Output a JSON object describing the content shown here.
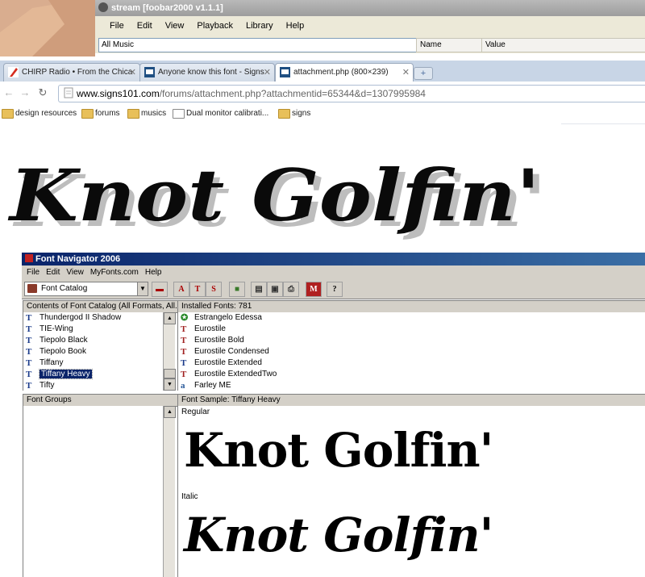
{
  "foobar": {
    "title": "stream   [foobar2000 v1.1.1]",
    "menu": [
      "File",
      "Edit",
      "View",
      "Playback",
      "Library",
      "Help"
    ],
    "playlist": "All Music",
    "columns": [
      "Name",
      "Value"
    ]
  },
  "browser": {
    "tabs": [
      {
        "label": "CHIRP Radio • From the Chica",
        "icon": "chirp-favicon"
      },
      {
        "label": "Anyone know this font - Signs",
        "icon": "signs101-favicon"
      },
      {
        "label": "attachment.php (800×239)",
        "icon": "signs101-favicon"
      }
    ],
    "new_tab_label": "+",
    "address": {
      "host": "www.signs101.com",
      "path": "/forums/attachment.php?attachmentid=65344&d=1307995984"
    },
    "bookmarks": [
      {
        "label": "design resources",
        "icon": "folder-icon"
      },
      {
        "label": "forums",
        "icon": "folder-icon"
      },
      {
        "label": "musics",
        "icon": "folder-icon"
      },
      {
        "label": "Dual monitor calibrati...",
        "icon": "site-icon"
      },
      {
        "label": "signs",
        "icon": "folder-icon"
      }
    ]
  },
  "image": {
    "text": "Knot Golfin'"
  },
  "fontnav": {
    "title": "Font Navigator 2006",
    "menu": [
      "File",
      "Edit",
      "View",
      "MyFonts.com",
      "Help"
    ],
    "combo": "Font Catalog",
    "toolbar_letters": [
      "A",
      "T",
      "S",
      "M",
      "?"
    ],
    "contents_header": "Contents of Font Catalog  (All Formats, All...",
    "installed_header": "Installed Fonts: 781",
    "left_fonts": [
      "Thundergod II Shadow",
      "TIE-Wing",
      "Tiepolo Black",
      "Tiepolo Book",
      "Tiffany",
      "Tiffany Heavy",
      "Tifty"
    ],
    "right_fonts": [
      "Estrangelo Edessa",
      "Eurostile",
      "Eurostile Bold",
      "Eurostile Condensed",
      "Eurostile Extended",
      "Eurostile ExtendedTwo",
      "Farley ME"
    ],
    "groups_header": "Font Groups",
    "sample_header": "Font Sample:   Tiffany Heavy",
    "regular_label": "Regular",
    "italic_label": "Italic",
    "sample_text": "Knot Golfin'"
  }
}
